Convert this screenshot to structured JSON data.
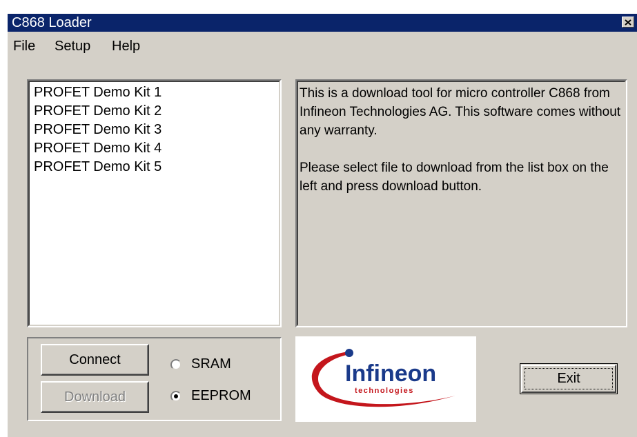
{
  "window": {
    "title": "C868 Loader",
    "close_icon": "close-x-icon"
  },
  "menu": {
    "items": [
      {
        "label": "File"
      },
      {
        "label": "Setup"
      },
      {
        "label": "Help"
      }
    ]
  },
  "file_list": {
    "items": [
      "PROFET Demo Kit 1",
      "PROFET Demo Kit 2",
      "PROFET Demo Kit 3",
      "PROFET Demo Kit 4",
      "PROFET Demo Kit 5"
    ]
  },
  "info": {
    "paragraph1": "This is a download tool for micro controller C868 from Infineon Technologies AG. This software comes without any warranty.",
    "paragraph2": "Please select file to download from the list box on the left and press download button."
  },
  "controls": {
    "connect_label": "Connect",
    "download_label": "Download",
    "download_enabled": false,
    "memory_options": [
      {
        "label": "SRAM",
        "selected": false
      },
      {
        "label": "EEPROM",
        "selected": true
      }
    ]
  },
  "logo": {
    "brand_name": "Infineon",
    "tagline": "technologies",
    "brand_color": "#1a3a8a",
    "swoosh_color": "#c4161c"
  },
  "exit_label": "Exit",
  "colors": {
    "titlebar": "#0a246a",
    "window_face": "#d4d0c8",
    "list_background": "#ffffff"
  }
}
